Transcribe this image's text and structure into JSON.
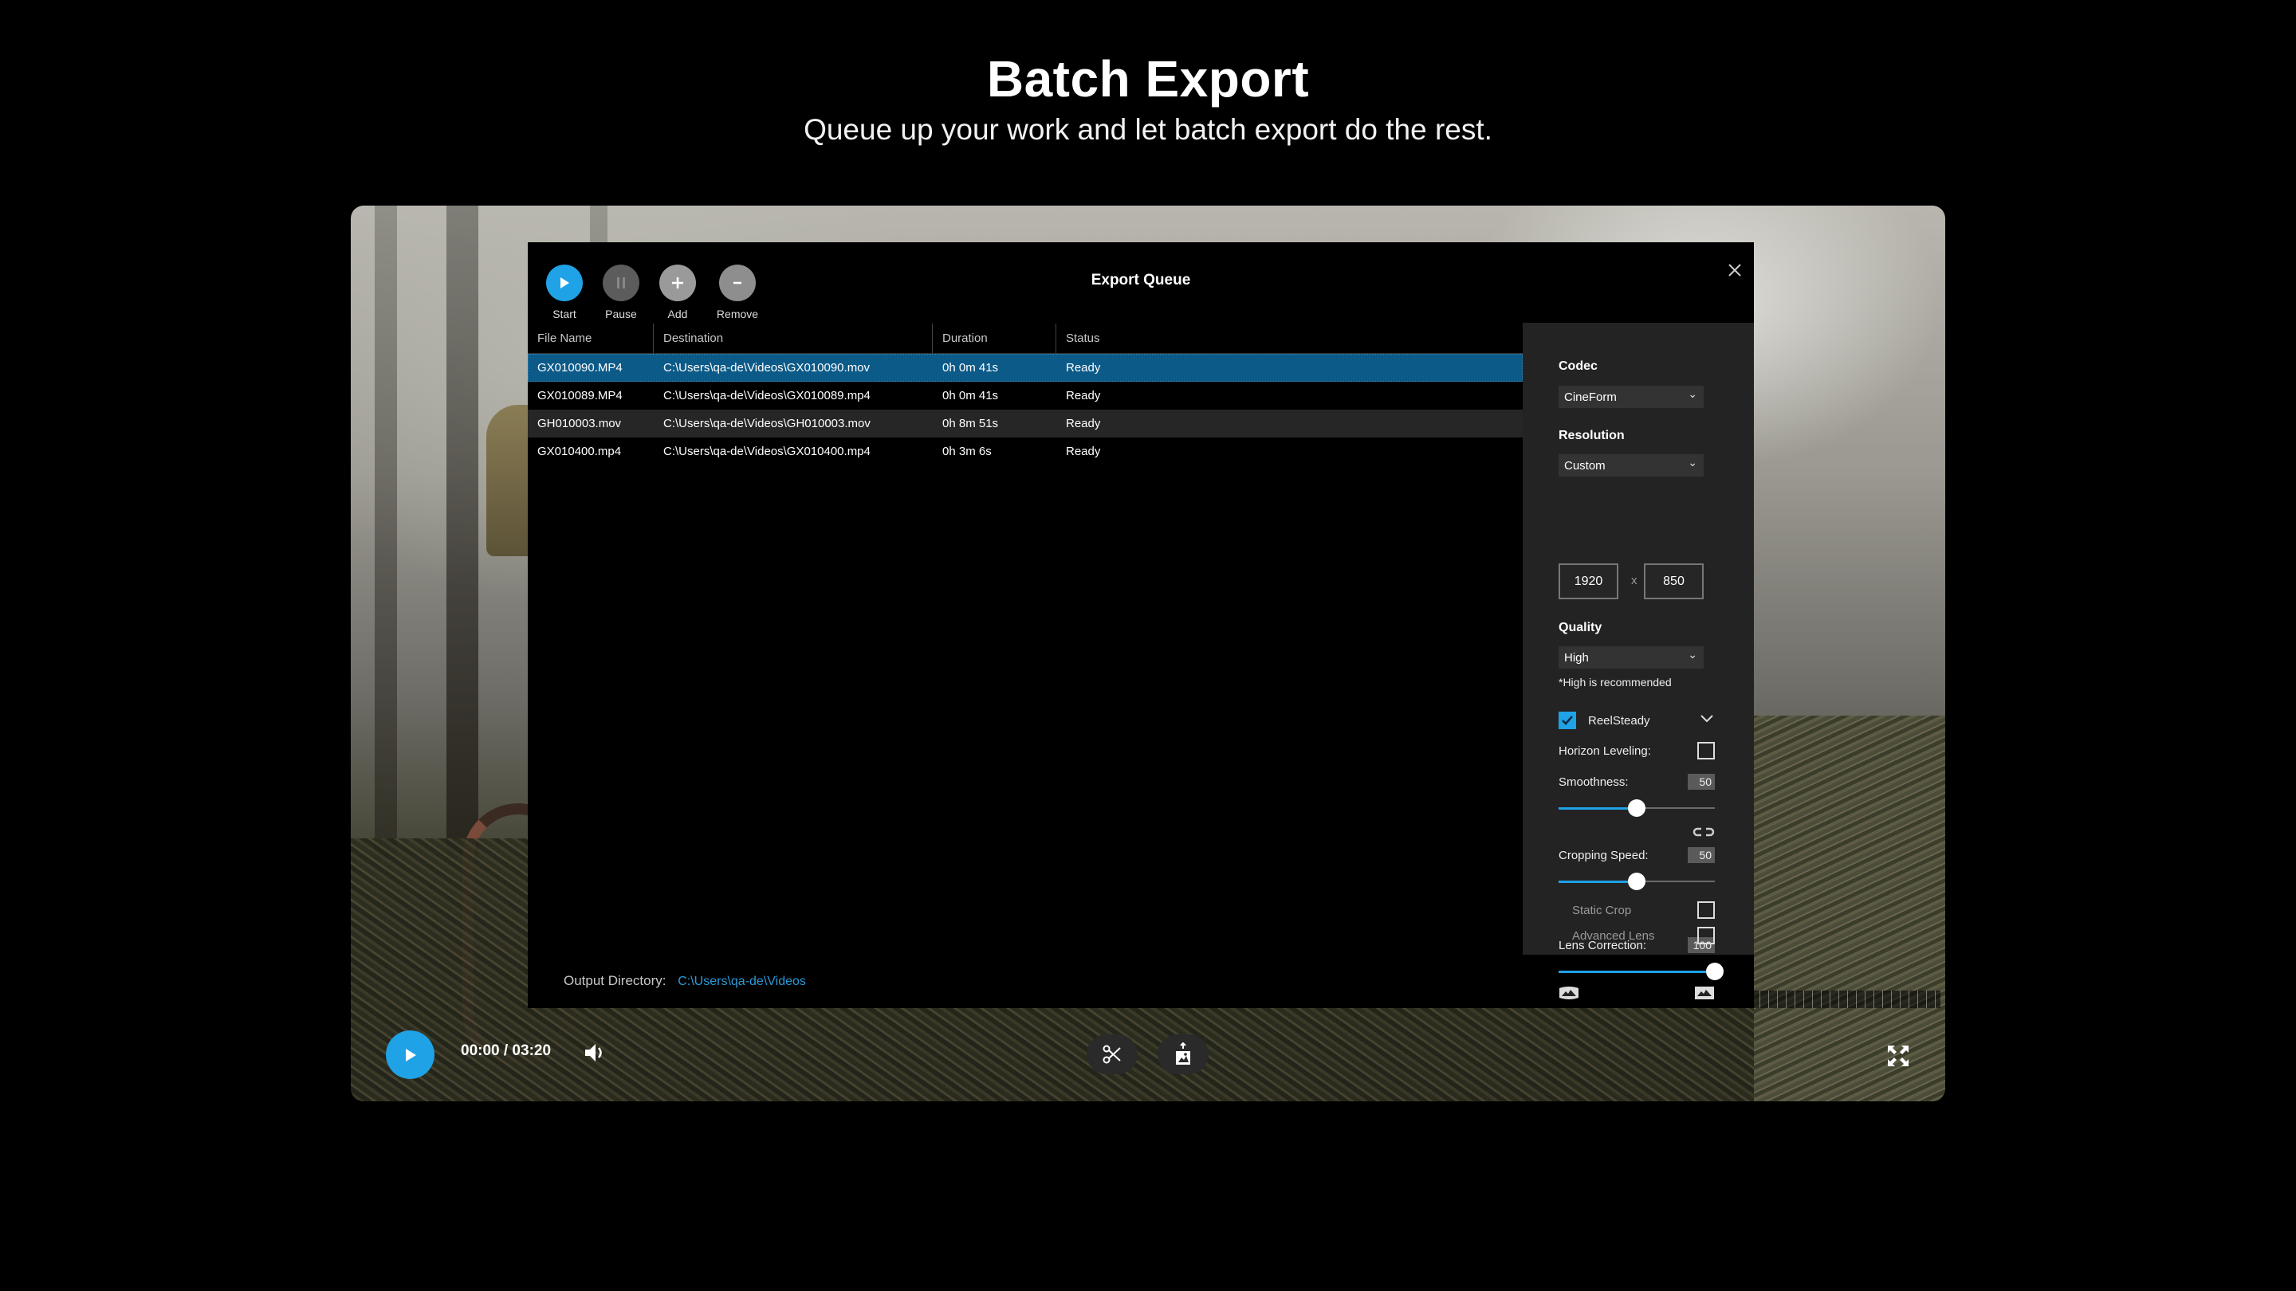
{
  "hero": {
    "title": "Batch Export",
    "subtitle": "Queue up your work and let batch export do the rest."
  },
  "modal": {
    "title": "Export Queue",
    "close_icon": "close-icon",
    "toolbar": [
      {
        "label": "Start",
        "icon": "play-icon"
      },
      {
        "label": "Pause",
        "icon": "pause-icon"
      },
      {
        "label": "Add",
        "icon": "plus-icon"
      },
      {
        "label": "Remove",
        "icon": "minus-icon"
      }
    ],
    "table": {
      "columns": [
        "File Name",
        "Destination",
        "Duration",
        "Status"
      ],
      "rows": [
        {
          "file": "GX010090.MP4",
          "dest": "C:\\Users\\qa-de\\Videos\\GX010090.mov",
          "duration": "0h 0m 41s",
          "status": "Ready",
          "selected": true
        },
        {
          "file": "GX010089.MP4",
          "dest": "C:\\Users\\qa-de\\Videos\\GX010089.mp4",
          "duration": "0h 0m 41s",
          "status": "Ready"
        },
        {
          "file": "GH010003.mov",
          "dest": "C:\\Users\\qa-de\\Videos\\GH010003.mov",
          "duration": "0h 8m 51s",
          "status": "Ready"
        },
        {
          "file": "GX010400.mp4",
          "dest": "C:\\Users\\qa-de\\Videos\\GX010400.mp4",
          "duration": "0h 3m 6s",
          "status": "Ready"
        }
      ]
    },
    "output": {
      "label": "Output Directory:",
      "path": "C:\\Users\\qa-de\\Videos"
    },
    "settings": {
      "codec": {
        "label": "Codec",
        "value": "CineForm"
      },
      "resolution": {
        "label": "Resolution",
        "value": "Custom",
        "width": "1920",
        "height": "850",
        "separator": "x"
      },
      "quality": {
        "label": "Quality",
        "value": "High",
        "hint": "*High is recommended"
      },
      "reelsteady": {
        "label": "ReelSteady",
        "checked": true
      },
      "horizon_leveling": {
        "label": "Horizon Leveling:",
        "checked": false
      },
      "smoothness": {
        "label": "Smoothness:",
        "value": "50",
        "percent": 50
      },
      "link_icon": "link-icon",
      "cropping_speed": {
        "label": "Cropping Speed:",
        "value": "50",
        "percent": 50
      },
      "static_crop": {
        "label": "Static Crop",
        "checked": false
      },
      "lens_correction": {
        "label": "Lens Correction:",
        "value": "100",
        "percent": 100
      },
      "advanced_lens": {
        "label": "Advanced Lens",
        "checked": false
      }
    }
  },
  "player": {
    "timecode": "00:00 / 03:20",
    "current": "00:00",
    "total": "03:20"
  },
  "colors": {
    "accent": "#1fa2e6",
    "selected_row": "#0c5a88",
    "panel": "#232323",
    "link": "#2b9ad8"
  }
}
